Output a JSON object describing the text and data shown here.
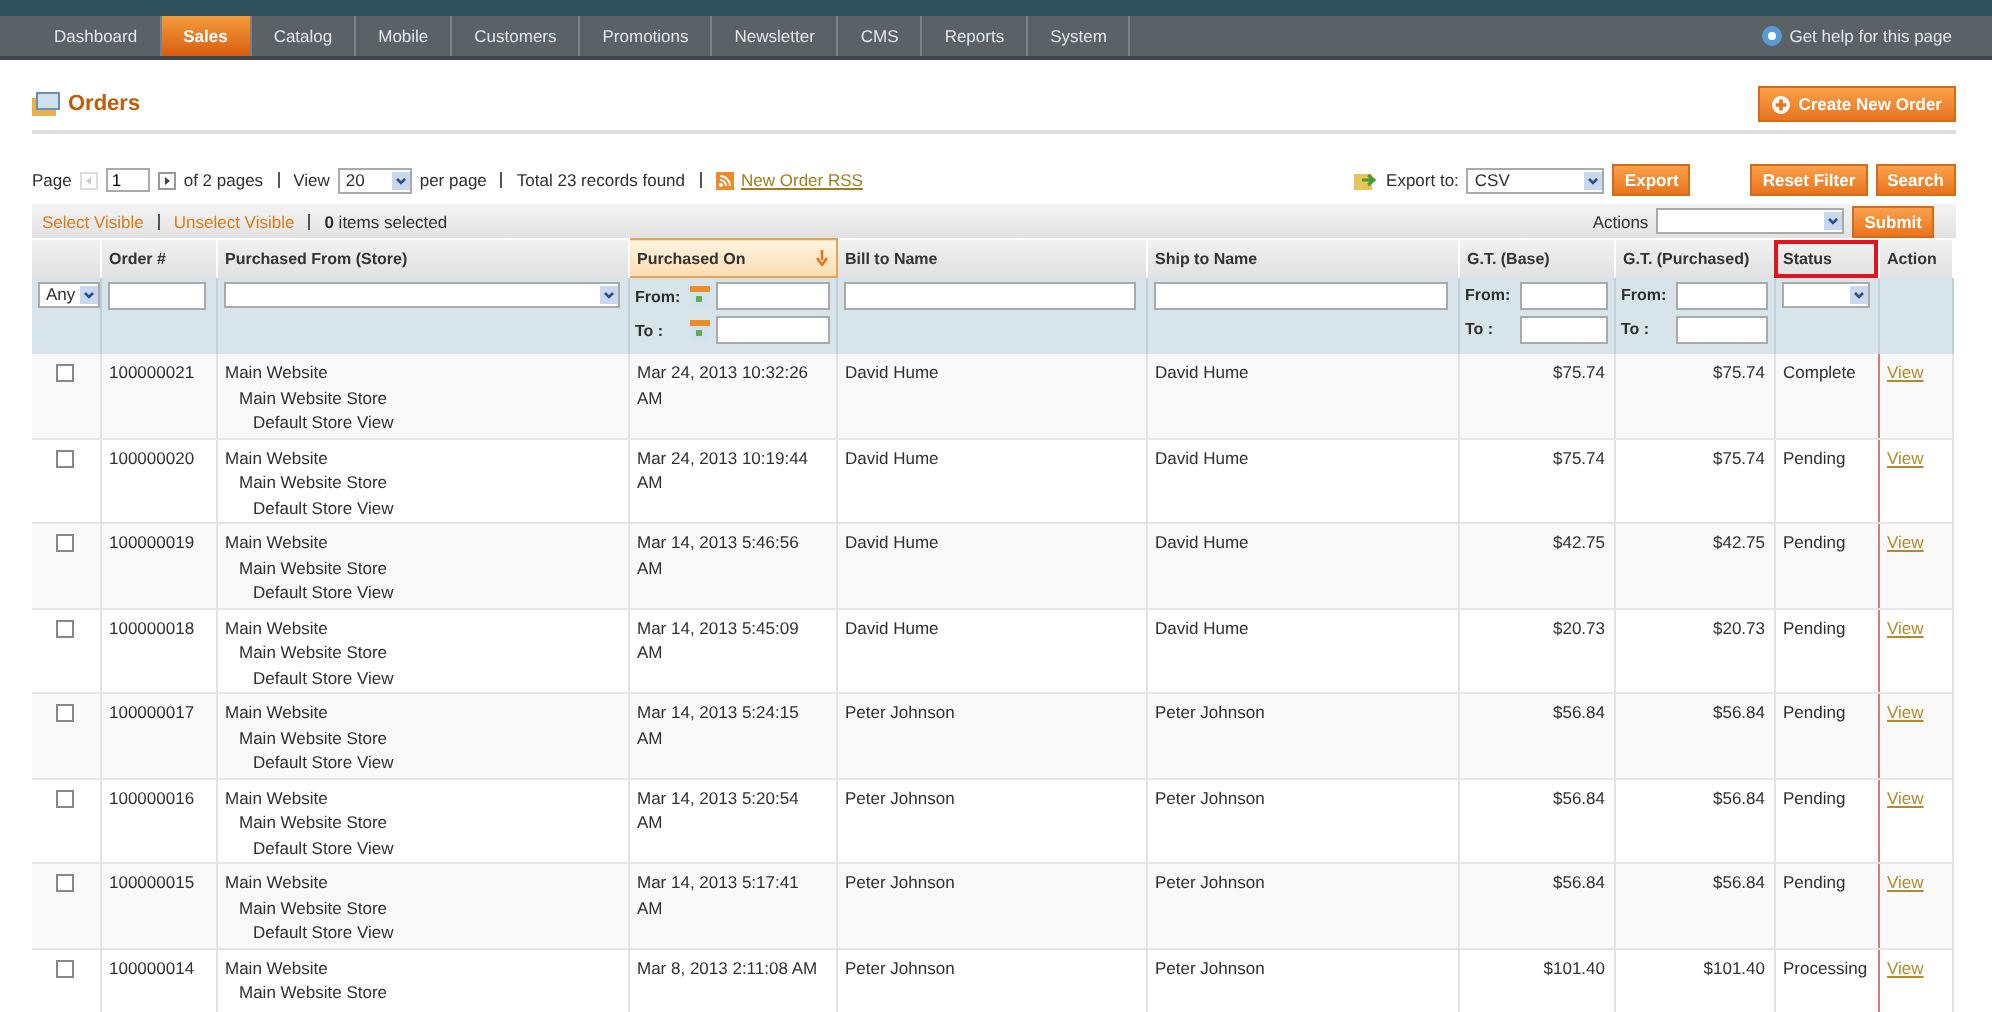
{
  "nav": {
    "items": [
      {
        "label": "Dashboard",
        "selected": false
      },
      {
        "label": "Sales",
        "selected": true
      },
      {
        "label": "Catalog",
        "selected": false
      },
      {
        "label": "Mobile",
        "selected": false
      },
      {
        "label": "Customers",
        "selected": false
      },
      {
        "label": "Promotions",
        "selected": false
      },
      {
        "label": "Newsletter",
        "selected": false
      },
      {
        "label": "CMS",
        "selected": false
      },
      {
        "label": "Reports",
        "selected": false
      },
      {
        "label": "System",
        "selected": false
      }
    ],
    "help": "Get help for this page"
  },
  "page_title": "Orders",
  "create_button": "Create New Order",
  "pager": {
    "page_label": "Page",
    "page": "1",
    "of_pages": "of 2 pages",
    "view_label": "View",
    "per_page": "20",
    "per_page_label": "per page",
    "total": "Total 23 records found",
    "rss": "New Order RSS",
    "export_label": "Export to:",
    "export_format": "CSV",
    "export_button": "Export",
    "reset_button": "Reset Filter",
    "search_button": "Search"
  },
  "massaction": {
    "select_visible": "Select Visible",
    "unselect_visible": "Unselect Visible",
    "count": "0",
    "selected_label": "items selected",
    "actions_label": "Actions",
    "submit": "Submit"
  },
  "columns": [
    {
      "kind": "check",
      "filter": {
        "kind": "any",
        "label": "Any"
      },
      "sorted": false,
      "highlighted": false
    },
    {
      "kind": "text",
      "label": "Order #",
      "filter": {
        "kind": "text"
      },
      "sorted": false,
      "highlighted": false
    },
    {
      "kind": "store",
      "label": "Purchased From (Store)",
      "filter": {
        "kind": "select"
      },
      "sorted": false,
      "highlighted": false
    },
    {
      "kind": "text",
      "label": "Purchased On",
      "filter": {
        "kind": "date",
        "from_label": "From:",
        "to_label": "To :"
      },
      "sorted": true,
      "highlighted": false
    },
    {
      "kind": "text",
      "label": "Bill to Name",
      "filter": {
        "kind": "text"
      },
      "sorted": false,
      "highlighted": false
    },
    {
      "kind": "text",
      "label": "Ship to Name",
      "filter": {
        "kind": "text"
      },
      "sorted": false,
      "highlighted": false
    },
    {
      "kind": "money",
      "label": "G.T. (Base)",
      "filter": {
        "kind": "range",
        "from_label": "From:",
        "to_label": "To :"
      },
      "sorted": false,
      "highlighted": false
    },
    {
      "kind": "money",
      "label": "G.T. (Purchased)",
      "filter": {
        "kind": "range",
        "from_label": "From:",
        "to_label": "To :"
      },
      "sorted": false,
      "highlighted": false
    },
    {
      "kind": "text",
      "label": "Status",
      "filter": {
        "kind": "select"
      },
      "sorted": false,
      "highlighted": true
    },
    {
      "kind": "link",
      "label": "Action",
      "sorted": false,
      "highlighted": false
    }
  ],
  "rows": [
    {
      "checked": false,
      "cells": [
        "100000021",
        [
          "Main Website",
          "Main Website Store",
          "Default Store View"
        ],
        "Mar 24, 2013 10:32:26 AM",
        "David Hume",
        "David Hume",
        "$75.74",
        "$75.74",
        "Complete",
        "View"
      ]
    },
    {
      "checked": false,
      "cells": [
        "100000020",
        [
          "Main Website",
          "Main Website Store",
          "Default Store View"
        ],
        "Mar 24, 2013 10:19:44 AM",
        "David Hume",
        "David Hume",
        "$75.74",
        "$75.74",
        "Pending",
        "View"
      ]
    },
    {
      "checked": false,
      "cells": [
        "100000019",
        [
          "Main Website",
          "Main Website Store",
          "Default Store View"
        ],
        "Mar 14, 2013 5:46:56 AM",
        "David Hume",
        "David Hume",
        "$42.75",
        "$42.75",
        "Pending",
        "View"
      ]
    },
    {
      "checked": false,
      "cells": [
        "100000018",
        [
          "Main Website",
          "Main Website Store",
          "Default Store View"
        ],
        "Mar 14, 2013 5:45:09 AM",
        "David Hume",
        "David Hume",
        "$20.73",
        "$20.73",
        "Pending",
        "View"
      ]
    },
    {
      "checked": false,
      "cells": [
        "100000017",
        [
          "Main Website",
          "Main Website Store",
          "Default Store View"
        ],
        "Mar 14, 2013 5:24:15 AM",
        "Peter Johnson",
        "Peter Johnson",
        "$56.84",
        "$56.84",
        "Pending",
        "View"
      ]
    },
    {
      "checked": false,
      "cells": [
        "100000016",
        [
          "Main Website",
          "Main Website Store",
          "Default Store View"
        ],
        "Mar 14, 2013 5:20:54 AM",
        "Peter Johnson",
        "Peter Johnson",
        "$56.84",
        "$56.84",
        "Pending",
        "View"
      ]
    },
    {
      "checked": false,
      "cells": [
        "100000015",
        [
          "Main Website",
          "Main Website Store",
          "Default Store View"
        ],
        "Mar 14, 2013 5:17:41 AM",
        "Peter Johnson",
        "Peter Johnson",
        "$56.84",
        "$56.84",
        "Pending",
        "View"
      ]
    },
    {
      "checked": false,
      "cells": [
        "100000014",
        [
          "Main Website",
          "Main Website Store"
        ],
        "Mar 8, 2013 2:11:08 AM",
        "Peter Johnson",
        "Peter Johnson",
        "$101.40",
        "$101.40",
        "Processing",
        "View"
      ]
    }
  ]
}
